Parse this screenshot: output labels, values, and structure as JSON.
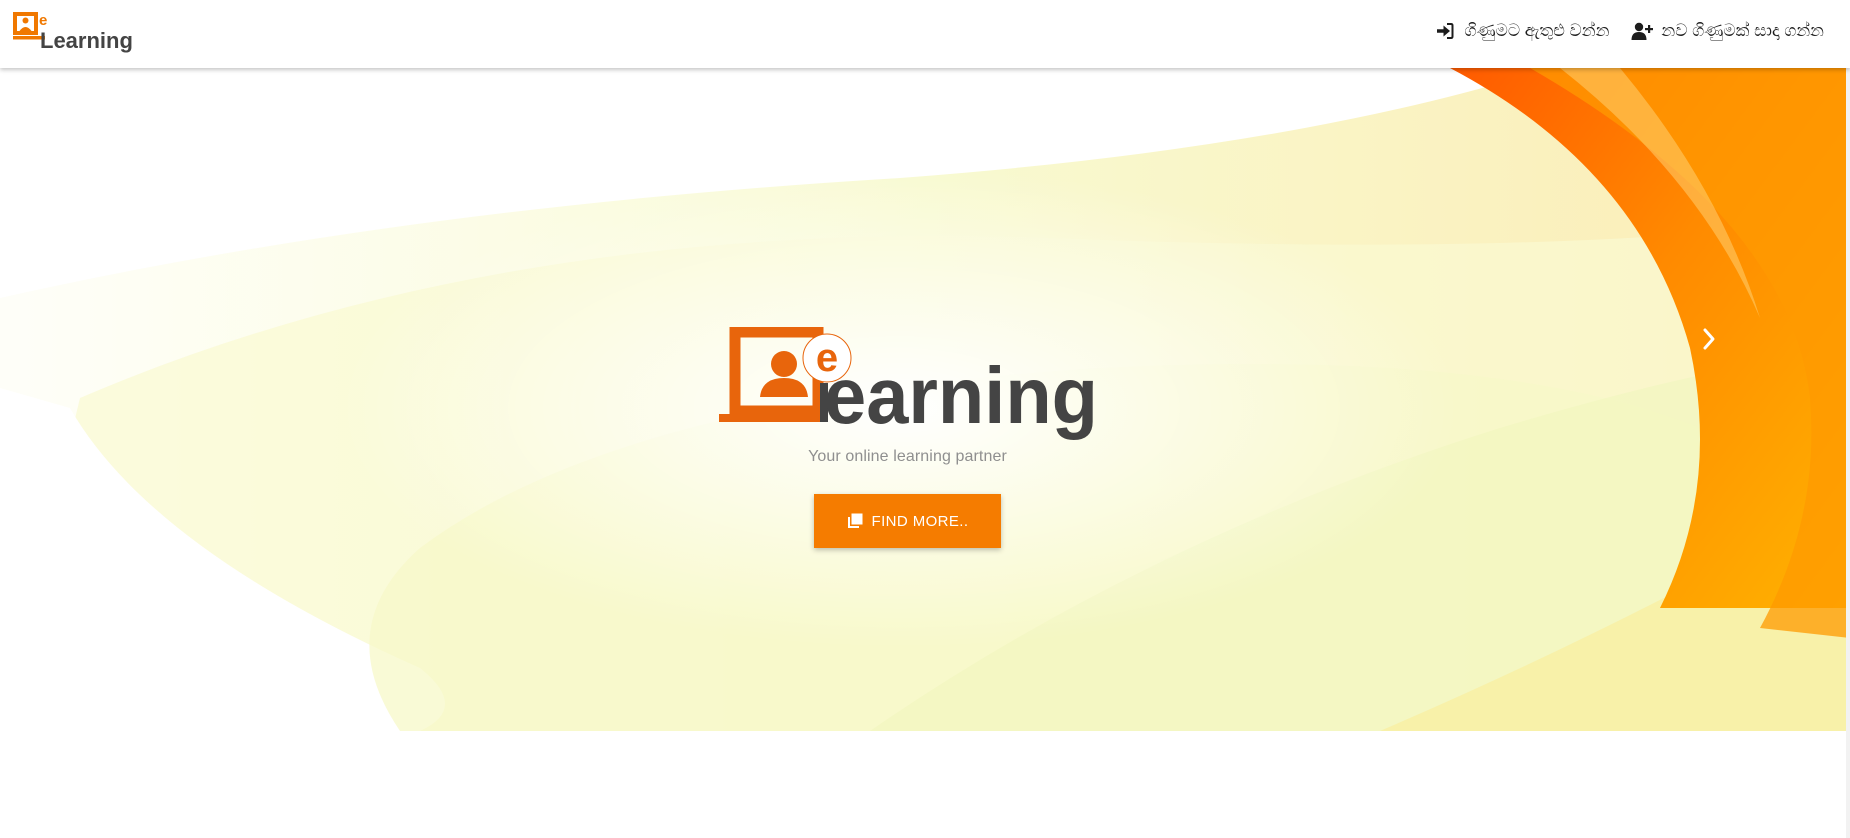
{
  "brand": {
    "logo_letter": "e",
    "logo_word": "Learning",
    "colors": {
      "orange": "#f07800",
      "dark": "#444444"
    }
  },
  "nav": {
    "login": {
      "label": "ගිණුමට ඇතුළු වන්න",
      "icon": "sign-in-icon"
    },
    "register": {
      "label": "නව ගිණුමක් සාදා ගන්න",
      "icon": "user-plus-icon"
    }
  },
  "hero": {
    "logo_letter": "e",
    "logo_word": "earning",
    "tagline": "Your online learning partner",
    "cta_label": "FIND MORE..",
    "cta_icon": "library-books-icon",
    "next_icon": "chevron-right-icon",
    "accent": "#f57c00"
  }
}
